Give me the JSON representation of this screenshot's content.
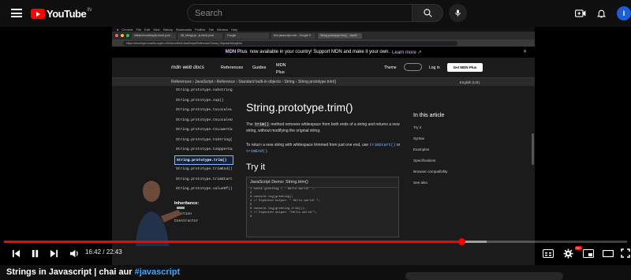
{
  "youtube": {
    "logo_text": "YouTube",
    "country_code": "IN",
    "search_placeholder": "Search",
    "avatar_initial": "I"
  },
  "browser": {
    "menu_items": [
      "Chrome",
      "File",
      "Edit",
      "View",
      "History",
      "Bookmarks",
      "Profiles",
      "Tab",
      "Window",
      "Help"
    ],
    "tabs": [
      "hiteshchoudhary/js-hindi-yout",
      "08_strings.js - js-hindi-yout",
      "Google",
      "trim javascript mdn - Google S",
      "String.prototype.trim() - JavaS"
    ],
    "url": "https://developer.mozilla.org/en-US/docs/Web/JavaScript/Reference/Global_Objects/String/trim"
  },
  "mdn": {
    "banner_plus": "MDN Plus",
    "banner_text": "now available in your country! Support MDN and make it your own.",
    "banner_link": "Learn more ↗",
    "logo": "mdn web docs",
    "nav": [
      "References",
      "Guides",
      "MDN Plus"
    ],
    "theme_label": "Theme",
    "login": "Log in",
    "get_plus": "Get MDN Plus",
    "breadcrumbs": "References › JavaScript › Reference › Standard built-in objects › String › String.prototype.trim()",
    "language": "English (US)",
    "sidebar": [
      "String.prototype.substring",
      "String.prototype.sup()",
      "String.prototype.toLocaleL",
      "String.prototype.toLocaleU",
      "String.prototype.toLowerCa",
      "String.prototype.toString(",
      "String.prototype.toUpperCa",
      "String.prototype.trim()",
      "String.prototype.trimEnd()",
      "String.prototype.trimStart",
      "String.prototype.valueOf()"
    ],
    "sidebar_active_index": 7,
    "inheritance_heading": "Inheritance:",
    "inheritance_items": [
      "Function",
      "Constructor"
    ],
    "page_title": "String.prototype.trim()",
    "desc_code": "trim()",
    "desc_text": "method removes whitespace from both ends of a string and returns a new string, without modifying the original string.",
    "desc2_text": "To return a new string with whitespace trimmed from just one end, use",
    "desc2_link1": "trimStart()",
    "desc2_or": "or",
    "desc2_link2": "trimEnd()",
    "try_heading": "Try it",
    "demo_title": "JavaScript Demo: String.trim()",
    "demo_lines": [
      "1 const greeting = '   Hello world!   ';",
      "2",
      "3 console.log(greeting);",
      "4 // Expected output: \"   Hello world!   \";",
      "5",
      "6 console.log(greeting.trim());",
      "7 // Expected output: \"Hello world!\";",
      "8"
    ],
    "toc_heading": "In this article",
    "toc": [
      "Try it",
      "Syntax",
      "Examples",
      "Specifications",
      "Browser compatibility",
      "See also"
    ]
  },
  "player": {
    "current_time": "16:42",
    "total_time": "22:43",
    "time_display": "16:42 / 22:43",
    "progress_fraction": 0.735,
    "loaded_fraction": 0.775,
    "hd_badge": "HD"
  },
  "video_title": {
    "text": "Strings in Javascript | chai aur ",
    "hashtag": "#javascript"
  },
  "colors": {
    "youtube_red": "#ff0000",
    "link_blue": "#3ea6ff",
    "background": "#0f0f0f"
  }
}
